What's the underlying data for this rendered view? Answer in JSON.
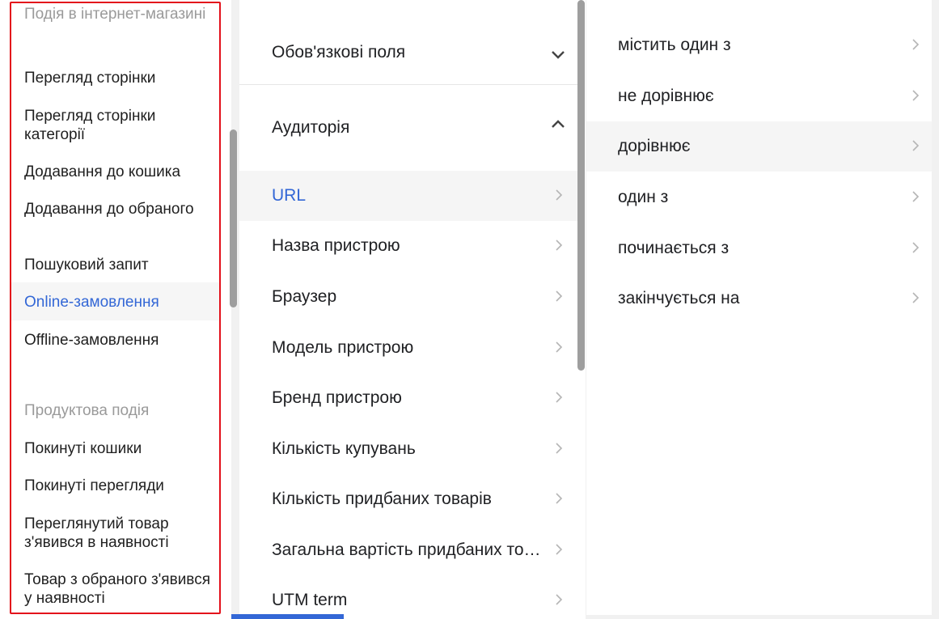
{
  "menu": {
    "groups": [
      {
        "header": "Подія в інтернет-магазині",
        "items": [
          "Перегляд сторінки",
          "Перегляд сторінки категорії",
          "Додавання до кошика",
          "Додавання до обраного",
          "Пошуковий запит",
          "Online-замовлення",
          "Offline-замовлення"
        ]
      },
      {
        "header": "Продуктова подія",
        "items": [
          "Покинуті кошики",
          "Покинуті перегляди",
          "Переглянутий товар з'явився в наявності",
          "Товар з обраного з'явився у наявності"
        ]
      }
    ],
    "active_item": "Online-замовлення"
  },
  "fields": {
    "sections": [
      {
        "label": "Обов'язкові поля",
        "state": "collapsed",
        "icon": "chevron-down-icon"
      },
      {
        "label": "Аудиторія",
        "state": "expanded",
        "icon": "chevron-up-icon"
      }
    ],
    "items": [
      "URL",
      "Назва пристрою",
      "Браузер",
      "Модель пристрою",
      "Бренд пристрою",
      "Кількість купувань",
      "Кількість придбаних товарів",
      "Загальна вартість придбаних товарів",
      "UTM term"
    ],
    "active_item": "URL"
  },
  "operators": {
    "items": [
      "містить один з",
      "не дорівнює",
      "дорівнює",
      "один з",
      "починається з",
      "закінчується на"
    ],
    "selected_item": "дорівнює"
  },
  "colors": {
    "accent": "#3367d6",
    "highlight_border": "#e3111b",
    "header_text": "#9a9a9a",
    "hover_bg": "#f5f5f5"
  }
}
